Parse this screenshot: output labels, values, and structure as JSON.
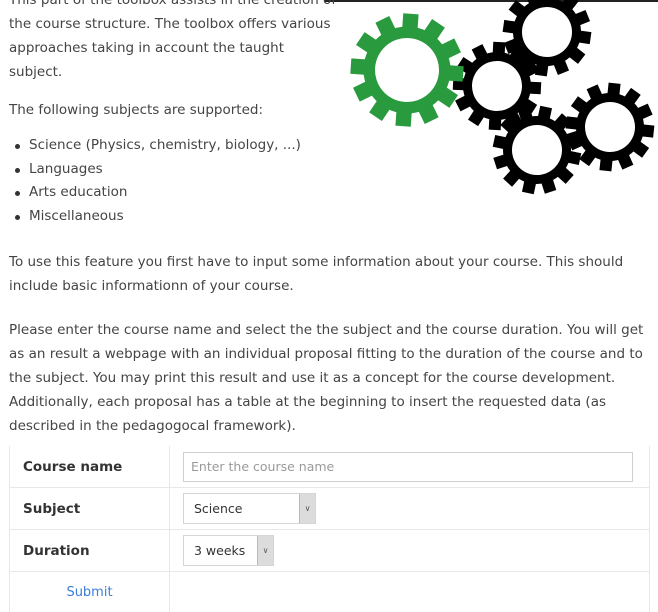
{
  "intro": {
    "line0": "This part of the toolbox assists in the creation of",
    "line1": "the course structure. The toolbox offers various",
    "line2": "approaches taking in account the taught subject."
  },
  "subjects_heading": "The following subjects are supported:",
  "subjects": [
    "Science (Physics, chemistry, biology, ...)",
    "Languages",
    "Arts education",
    "Miscellaneous"
  ],
  "paragraph_feature": "To use this feature you first have to input some information about your course. This should include basic informationn of your course.",
  "paragraph_instructions": "Please enter the course name and select the the subject and the course duration. You will get as an result a webpage with an individual proposal fitting to the duration of the course and to the subject. You may print this result and use it as a concept for the course development. Additionally, each proposal has a table at the beginning to insert the requested data (as described in the pedagogocal framework).",
  "form": {
    "course_name_label": "Course name",
    "course_name_placeholder": "Enter the course name",
    "course_name_value": "",
    "subject_label": "Subject",
    "subject_value": "Science",
    "duration_label": "Duration",
    "duration_value": "3 weeks",
    "submit_label": "Submit"
  },
  "illustration": {
    "name": "gears",
    "colors": {
      "accent_gear": "#2a9a3f",
      "gears": "#000000"
    }
  }
}
